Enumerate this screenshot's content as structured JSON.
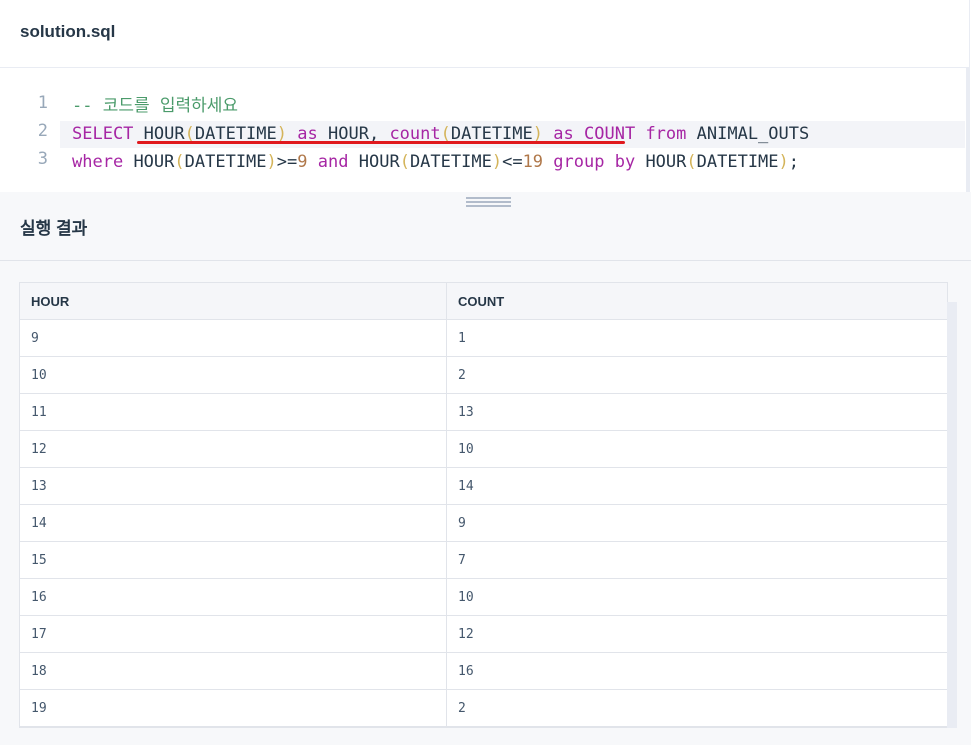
{
  "file": {
    "title": "solution.sql"
  },
  "editor": {
    "line_numbers": [
      "1",
      "2",
      "3"
    ]
  },
  "result": {
    "title": "실행 결과",
    "columns": [
      "HOUR",
      "COUNT"
    ],
    "rows": [
      [
        "9",
        "1"
      ],
      [
        "10",
        "2"
      ],
      [
        "11",
        "13"
      ],
      [
        "12",
        "10"
      ],
      [
        "13",
        "14"
      ],
      [
        "14",
        "9"
      ],
      [
        "15",
        "7"
      ],
      [
        "16",
        "10"
      ],
      [
        "17",
        "12"
      ],
      [
        "18",
        "16"
      ],
      [
        "19",
        "2"
      ]
    ]
  },
  "colors": {
    "keyword": "#a626a4",
    "comment": "#4b9b6b",
    "underline": "#e0191e"
  }
}
